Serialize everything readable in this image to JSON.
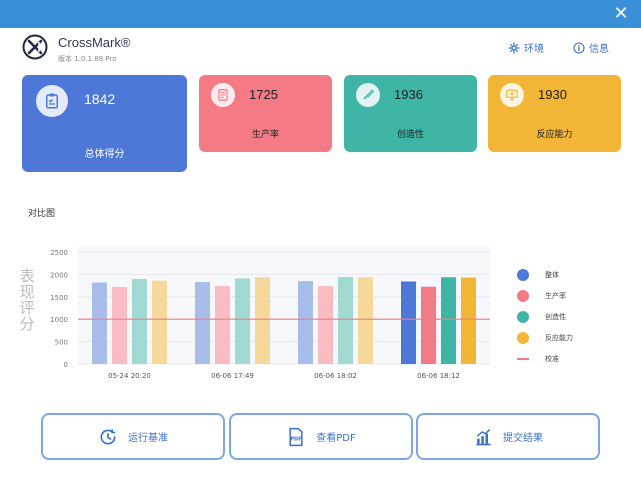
{
  "app": {
    "name": "CrossMark®",
    "version": "版本 1.0.1.88 Pro"
  },
  "top_links": {
    "environment": "环境",
    "info": "信息"
  },
  "cards": {
    "overall": {
      "score": "1842",
      "label": "总体得分",
      "color": "#4d78d8"
    },
    "productivity": {
      "score": "1725",
      "label": "生产率",
      "color": "#f47b86"
    },
    "creativity": {
      "score": "1936",
      "label": "创造性",
      "color": "#3fb5a6"
    },
    "responsiveness": {
      "score": "1930",
      "label": "反应能力",
      "color": "#f2b535"
    }
  },
  "section_title": "对比图",
  "chart_data": {
    "type": "bar",
    "ylabel": "表现评分",
    "ylim": [
      0,
      2500
    ],
    "yticks": [
      "2500",
      "2000",
      "1500",
      "1000",
      "500",
      "0"
    ],
    "categories": [
      "05-24 20:20",
      "06-06 17:49",
      "06-06 18:02",
      "06-06 18:12"
    ],
    "series": [
      {
        "name": "整体",
        "values": [
          1820,
          1830,
          1850,
          1842
        ],
        "color": "#4d78d8",
        "faded": "#a9bdea"
      },
      {
        "name": "生产率",
        "values": [
          1720,
          1740,
          1740,
          1725
        ],
        "color": "#f47b86",
        "faded": "#f8bcc2"
      },
      {
        "name": "创造性",
        "values": [
          1900,
          1910,
          1940,
          1936
        ],
        "color": "#3fb5a6",
        "faded": "#9fd9d1"
      },
      {
        "name": "反应能力",
        "values": [
          1860,
          1940,
          1940,
          1930
        ],
        "color": "#f2b535",
        "faded": "#f6d99a"
      }
    ],
    "baseline": {
      "name": "校准",
      "value": 1000,
      "color": "#f47b86"
    },
    "highlight_index": 3,
    "grid": true,
    "legend": "right"
  },
  "buttons": {
    "run": "运行基准",
    "pdf": "查看PDF",
    "submit": "提交结果"
  },
  "icons": {
    "close": "close-icon",
    "gear": "gear-icon",
    "info": "info-icon",
    "pdf_badge": "PDF"
  }
}
